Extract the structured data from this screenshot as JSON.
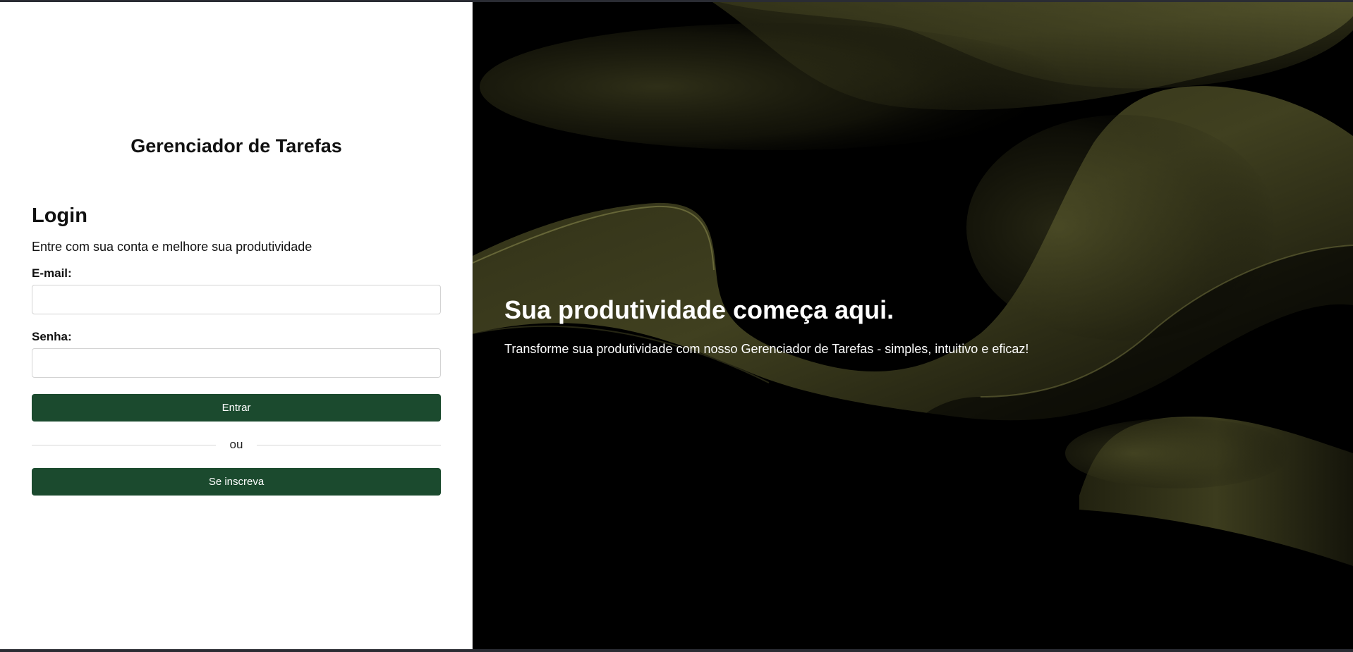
{
  "app": {
    "title": "Gerenciador de Tarefas"
  },
  "login": {
    "heading": "Login",
    "subtitle": "Entre com sua conta e melhore sua produtividade",
    "email_label": "E-mail:",
    "email_value": "",
    "email_placeholder": "",
    "password_label": "Senha:",
    "password_value": "",
    "password_placeholder": "",
    "submit_label": "Entrar",
    "divider_text": "ou",
    "signup_label": "Se inscreva"
  },
  "hero": {
    "title": "Sua produtividade começa aqui.",
    "text": "Transforme sua produtividade com nosso Gerenciador de Tarefas - simples, intuitivo e eficaz!"
  },
  "colors": {
    "primary_button": "#1b4a2e",
    "hero_background": "#000000",
    "wave_accent": "#4a4a26"
  }
}
